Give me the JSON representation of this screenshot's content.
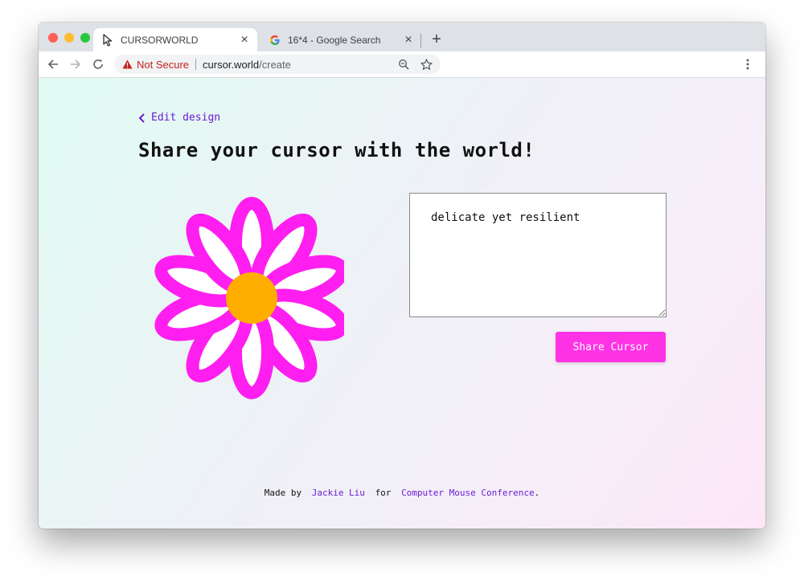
{
  "browser": {
    "tabs": [
      {
        "title": "CURSORWORLD",
        "active": true
      },
      {
        "title": "16*4 - Google Search",
        "active": false
      }
    ],
    "close_glyph": "×",
    "new_tab_glyph": "+",
    "omnibox": {
      "security_label": "Not Secure",
      "url_host": "cursor.world",
      "url_path": "/create"
    }
  },
  "page": {
    "back_link": "Edit design",
    "heading": "Share your cursor with the world!",
    "description_value": "delicate yet resilient",
    "share_button": "Share Cursor",
    "footer": {
      "made_by": "Made by",
      "author": "Jackie Liu",
      "for_text": "for",
      "event": "Computer Mouse Conference",
      "period": "."
    }
  },
  "colors": {
    "accent_purple": "#6a1bd6",
    "share_button_pink": "#ff33e6",
    "petal_outline": "#ff1ef0",
    "flower_center": "#ffae00",
    "warning_red": "#c5221f"
  }
}
